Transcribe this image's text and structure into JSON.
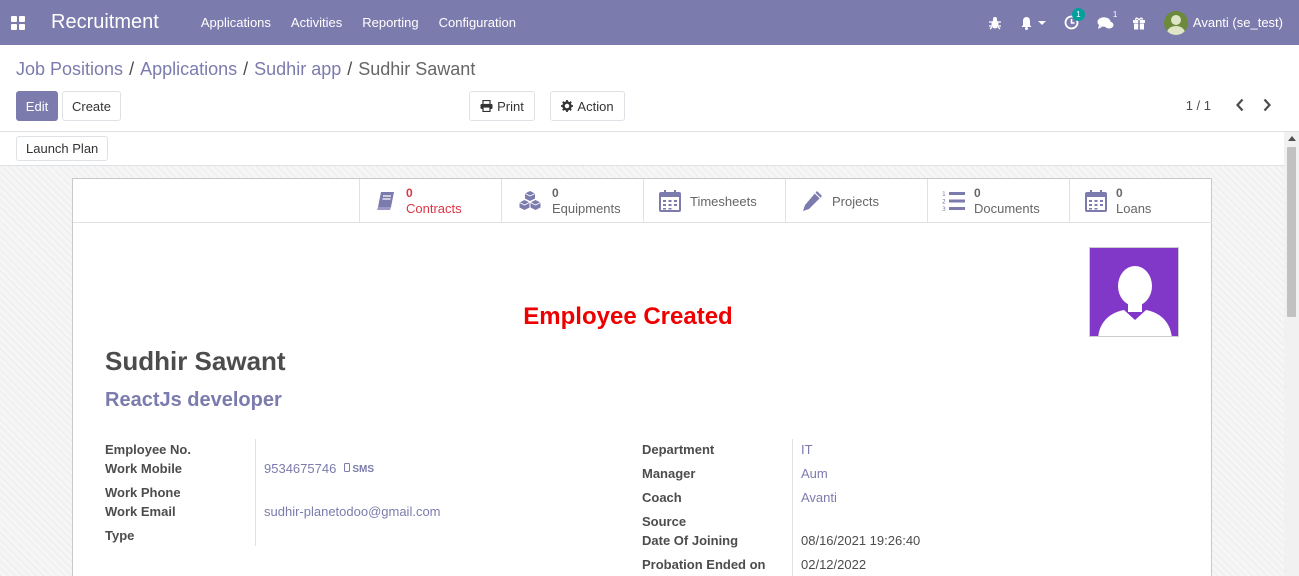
{
  "navbar": {
    "app_title": "Recruitment",
    "menu": [
      "Applications",
      "Activities",
      "Reporting",
      "Configuration"
    ],
    "activity_badge": "1",
    "messages_badge": "1",
    "user_name": "Avanti (se_test)"
  },
  "breadcrumb": {
    "items": [
      "Job Positions",
      "Applications",
      "Sudhir app"
    ],
    "separator": "/",
    "current": "Sudhir Sawant"
  },
  "toolbar": {
    "edit_label": "Edit",
    "create_label": "Create",
    "print_label": "Print",
    "action_label": "Action",
    "pager": "1 / 1"
  },
  "statusbar": {
    "launch_plan_label": "Launch Plan"
  },
  "smart_buttons": {
    "contracts": {
      "count": "0",
      "label": "Contracts"
    },
    "equipments": {
      "count": "0",
      "label": "Equipments"
    },
    "timesheets": {
      "label": "Timesheets"
    },
    "projects": {
      "label": "Projects"
    },
    "documents": {
      "count": "0",
      "label": "Documents"
    },
    "loans": {
      "count": "0",
      "label": "Loans"
    }
  },
  "ribbon": "Employee Created",
  "employee": {
    "name": "Sudhir Sawant",
    "job_title": "ReactJs developer"
  },
  "left_fields": {
    "employee_no_label": "Employee No.",
    "employee_no_value": "",
    "work_mobile_label": "Work Mobile",
    "work_mobile_value": "9534675746",
    "sms_label": "SMS",
    "work_phone_label": "Work Phone",
    "work_phone_value": "",
    "work_email_label": "Work Email",
    "work_email_value": "sudhir-planetodoo@gmail.com",
    "type_label": "Type",
    "type_value": ""
  },
  "right_fields": {
    "department_label": "Department",
    "department_value": "IT",
    "manager_label": "Manager",
    "manager_value": "Aum",
    "coach_label": "Coach",
    "coach_value": "Avanti",
    "source_label": "Source",
    "source_value": "",
    "date_joining_label": "Date Of Joining",
    "date_joining_value": "08/16/2021 19:26:40",
    "probation_label": "Probation Ended on",
    "probation_value": "02/12/2022"
  },
  "colors": {
    "brand": "#7c7bad",
    "ribbon": "#e00000",
    "avatar_bg": "#8138c9",
    "contracts": "#dc3545"
  }
}
